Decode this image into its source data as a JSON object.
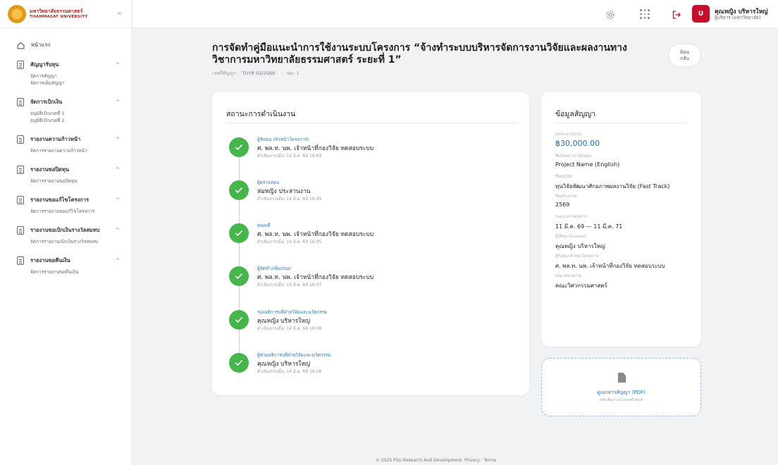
{
  "brand": {
    "name_th": "มหาวิทยาลัยธรรมศาสตร์",
    "name_en": "THAMMASAT UNIVERSITY",
    "collapse_icon": "«"
  },
  "sidebar": {
    "home": "หน้าแรก",
    "groups": [
      {
        "label": "สัญญารับทุน",
        "items": [
          "จัดการสัญญา",
          "จัดการเพิ่มสัญญา"
        ]
      },
      {
        "label": "จัดการเบิกเงิน",
        "items": [
          "อนุมัติเบิกงวดที่ 1",
          "อนุมัติเบิกงวดที่ 2"
        ]
      },
      {
        "label": "รายงานความก้าวหน้า",
        "items": [
          "จัดการรายงานความก้าวหน้า"
        ]
      },
      {
        "label": "รายงานขอปิดทุน",
        "items": [
          "จัดการรายงานขอปิดทุน"
        ]
      },
      {
        "label": "รายงานขอแก้ไขโครงการ",
        "items": [
          "จัดการรายงานขอแก้ไขโครงการ"
        ]
      },
      {
        "label": "รายงานขอเบิกเงินรางวัลสมทบ",
        "items": [
          "จัดการรายงานเบิกเงินรางวัลสมทบ"
        ]
      },
      {
        "label": "รายงานขอคืนเงิน",
        "items": [
          "จัดการรายงานขอคืนเงิน"
        ]
      }
    ]
  },
  "topbar": {
    "avatar_letter": "U",
    "user_name": "คุณหญิง บริหารใหญ่",
    "user_role": "ผู้บริหาร (มหาวิทยาลัย)"
  },
  "header": {
    "title": "การจัดทำคู่มือแนะนำการใช้งานระบบโครงการ “จ้างทำระบบบริหารจัดการงานวิจัยและผลงานทางวิชาการมหาวิทยาลัยธรรมศาสตร์ ระยะที่ 1”",
    "contract_label": "เลขที่สัญญา:",
    "contract_no": "TUYR 02/2569",
    "version": "Ver. 1",
    "back_label": "ย้อน\nกลับ"
  },
  "status": {
    "title": "สถานะการดำเนินงาน",
    "steps": [
      {
        "role": "ผู้รับทุน (หัวหน้าโครงการ)",
        "name": "ศ. พล.ท. นพ. เจ้าหน้าที่กองวิจัย ทดสอบระบบ",
        "time": "ดำเนินการเมื่อ: 14 มี.ค. 69 16:03"
      },
      {
        "role": "ผู้ตรวจสอบ",
        "name": "สมหญิง ประสานงาน",
        "time": "ดำเนินการเมื่อ: 14 มี.ค. 69 16:05"
      },
      {
        "role": "คณบดี",
        "name": "ศ. พล.ท. นพ. เจ้าหน้าที่กองวิจัย ทดสอบระบบ",
        "time": "ดำเนินการเมื่อ: 14 มี.ค. 69 16:05"
      },
      {
        "role": "ผู้จัดทำ/เพิ่มเสนอ",
        "name": "ศ. พล.ท. นพ. เจ้าหน้าที่กองวิจัย ทดสอบระบบ",
        "time": "ดำเนินการเมื่อ: 14 มี.ค. 69 16:07"
      },
      {
        "role": "รองอธิการบดีฝ่ายวิจัยและนวัตกรรม",
        "name": "คุณหญิง บริหารใหญ่",
        "time": "ดำเนินการเมื่อ: 14 มี.ค. 69 16:08"
      },
      {
        "role": "ผู้ช่วยอธิการบดีฝ่ายวิจัยและนวัตกรรม",
        "name": "คุณหญิง บริหารใหญ่",
        "time": "ดำเนินการเมื่อ: 14 มี.ค. 69 16:08"
      }
    ]
  },
  "info": {
    "title": "ข้อมูลสัญญา",
    "fields": [
      {
        "label": "งบประมาณรวม",
        "value": "฿30,000.00"
      },
      {
        "label": "ชื่อโครงการ (อังกฤษ)",
        "value": "Project Name (English)"
      },
      {
        "label": "ชื่อทุนวิจัย",
        "value": "ทุนวิจัยพัฒนาศักยภาพผลงานวิจัย (Fast Track)"
      },
      {
        "label": "ปีงบประมาณ",
        "value": "2569"
      },
      {
        "label": "ระยะเวลาโครงการ",
        "value": "11 มี.ค. 69 — 11 มี.ค. 71"
      },
      {
        "label": "ผู้ให้ทุน (Grantor)",
        "value": "คุณหญิง บริหารใหญ่"
      },
      {
        "label": "ผู้รับทุน (หัวหน้าโครงการ)",
        "value": "ศ. พล.ท. นพ. เจ้าหน้าที่กองวิจัย ทดสอบระบบ"
      },
      {
        "label": "คณะ/หน่วยงาน",
        "value": "คณะวิศวกรรมศาสตร์"
      }
    ]
  },
  "pdf": {
    "label": "ดูเอกสารสัญญา (PDF)",
    "sub": "คลิกเพื่อดาวน์โหลดหรือพิมพ์"
  },
  "footer": {
    "copyright": "© 2025 PSU Research And Development.",
    "privacy": "Privacy",
    "sep": "·",
    "terms": "Terms"
  },
  "colors": {
    "brand_red": "#c8102e",
    "success_green": "#45b649",
    "link_blue": "#2f78c7"
  }
}
